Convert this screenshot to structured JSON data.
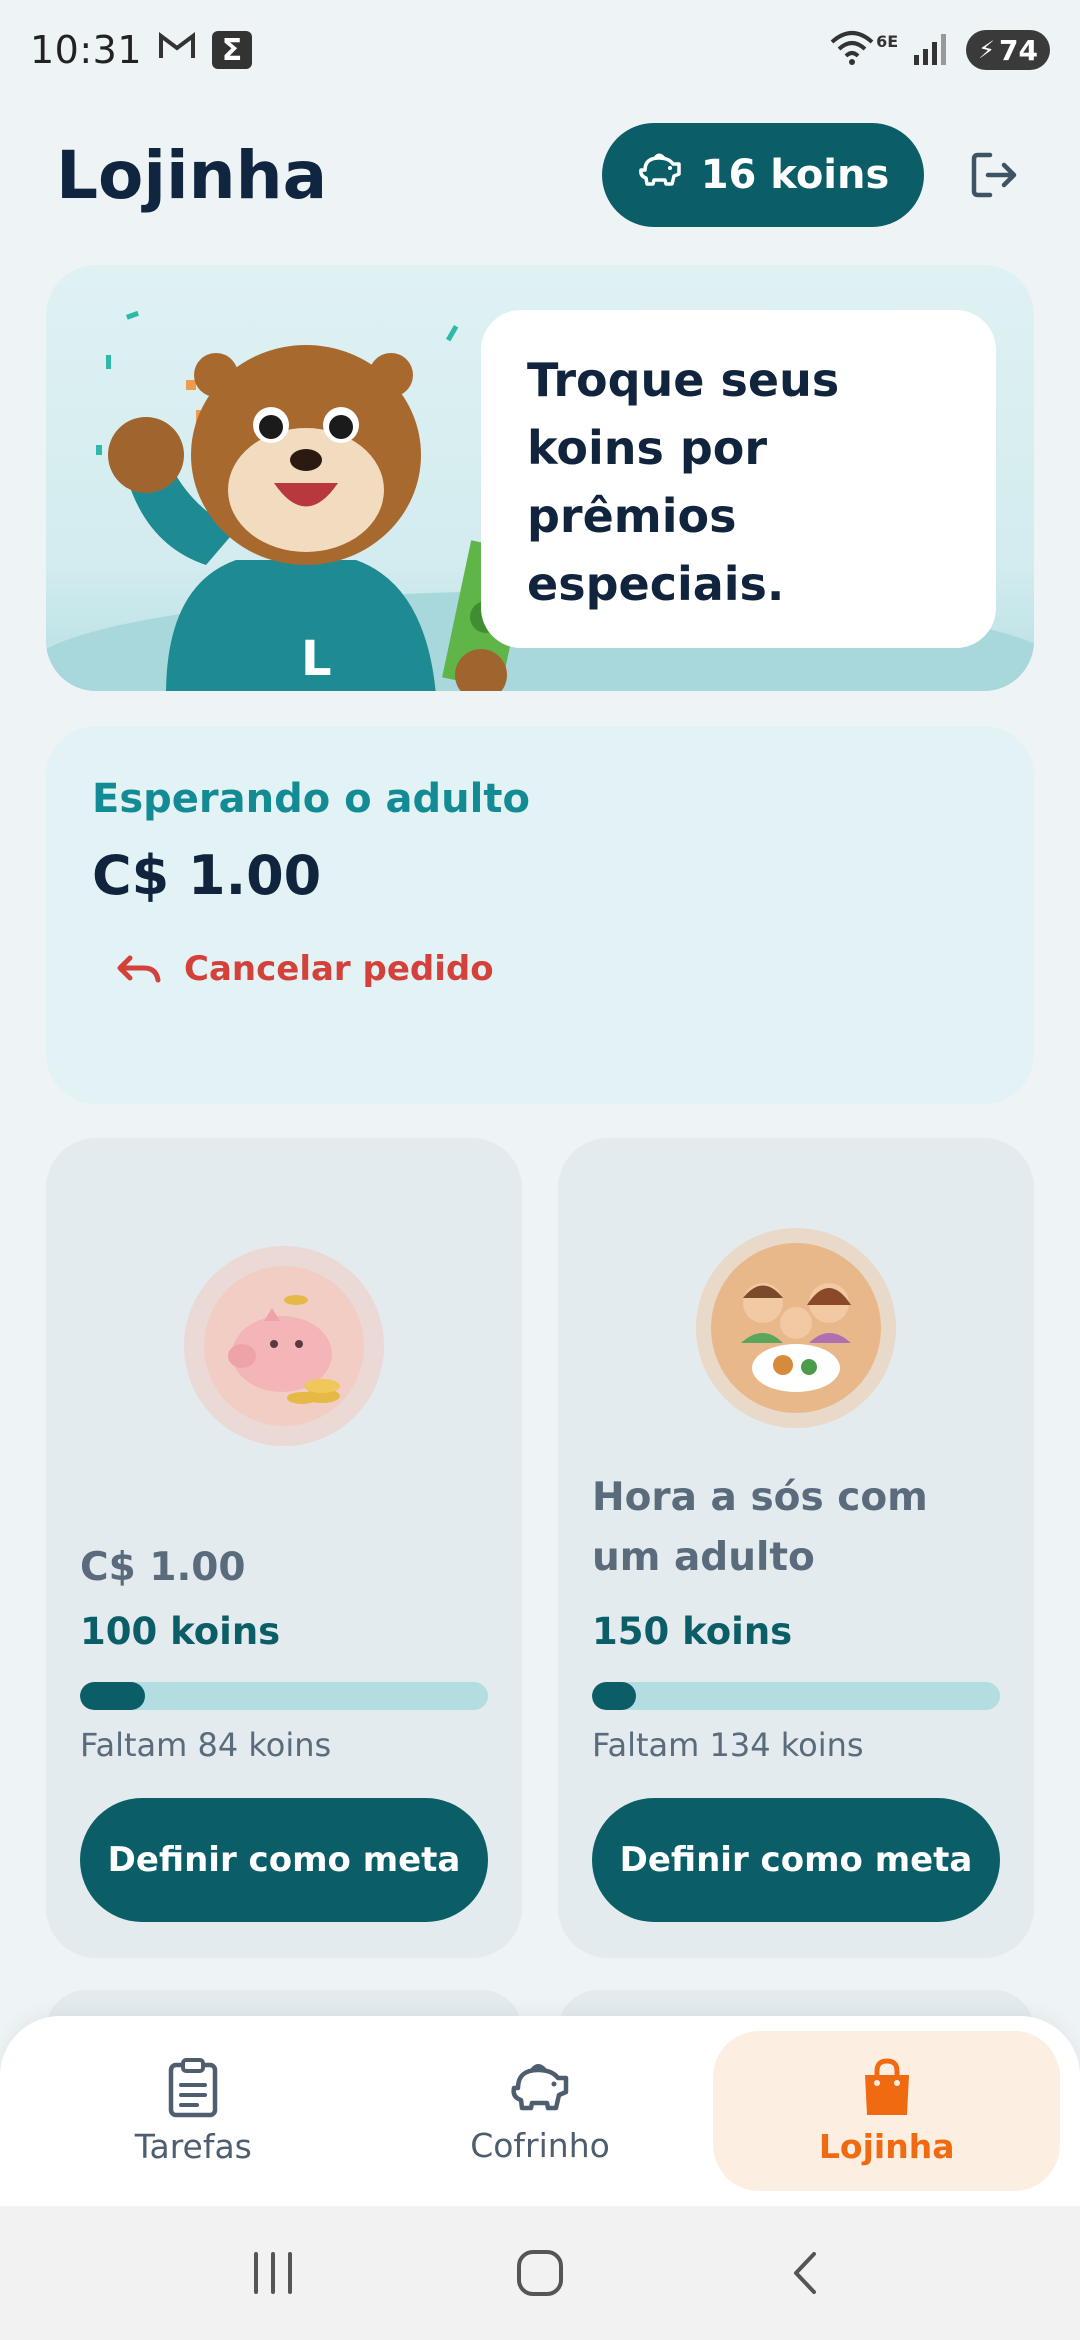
{
  "status_bar": {
    "time": "10:31",
    "network": "6E",
    "battery": "74"
  },
  "header": {
    "title": "Lojinha",
    "koins_label": "16 koins"
  },
  "banner": {
    "message": "Troque seus koins por prêmios especiais.",
    "mascot_letter": "L"
  },
  "pending": {
    "status": "Esperando o adulto",
    "title": "C$ 1.00",
    "cancel_label": "Cancelar pedido"
  },
  "rewards": [
    {
      "title": "C$ 1.00",
      "cost": "100 koins",
      "remaining": "Faltam 84 koins",
      "progress": 0.16,
      "button": "Definir como meta",
      "icon": "piggy-bank-icon"
    },
    {
      "title": "Hora a sós com um adulto",
      "cost": "150 koins",
      "remaining": "Faltam 134 koins",
      "progress": 0.107,
      "button": "Definir como meta",
      "icon": "family-meal-icon"
    }
  ],
  "nav": {
    "tasks": "Tarefas",
    "piggy": "Cofrinho",
    "shop": "Lojinha"
  },
  "colors": {
    "primary": "#0b5e68",
    "accent": "#f06a12",
    "danger": "#d4403a",
    "status_teal": "#128b94"
  }
}
